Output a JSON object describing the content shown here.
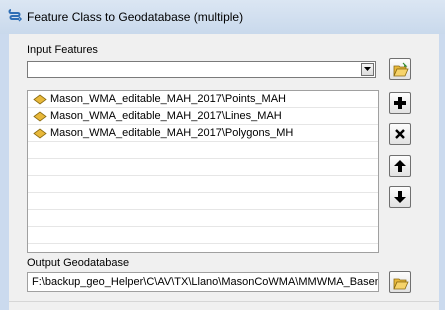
{
  "window": {
    "title": "Feature Class to Geodatabase (multiple)",
    "icon": "toolbox-script-icon"
  },
  "input_features": {
    "label": "Input Features",
    "combo_value": "",
    "items": [
      {
        "text": "Mason_WMA_editable_MAH_2017\\Points_MAH"
      },
      {
        "text": "Mason_WMA_editable_MAH_2017\\Lines_MAH"
      },
      {
        "text": "Mason_WMA_editable_MAH_2017\\Polygons_MH"
      }
    ]
  },
  "output": {
    "label": "Output Geodatabase",
    "value": "F:\\backup_geo_Helper\\C\\AV\\TX\\Llano\\MasonCoWMA\\MMWMA_Basema"
  },
  "icons": {
    "browse": "folder-open-icon",
    "add": "plus-icon",
    "remove": "x-icon",
    "up": "arrow-up-icon",
    "down": "arrow-down-icon",
    "feature_class": "feature-class-icon"
  },
  "colors": {
    "titlebar": "#c9d9ec",
    "panel": "#f0f0f0",
    "folder": "#e8b83a"
  }
}
